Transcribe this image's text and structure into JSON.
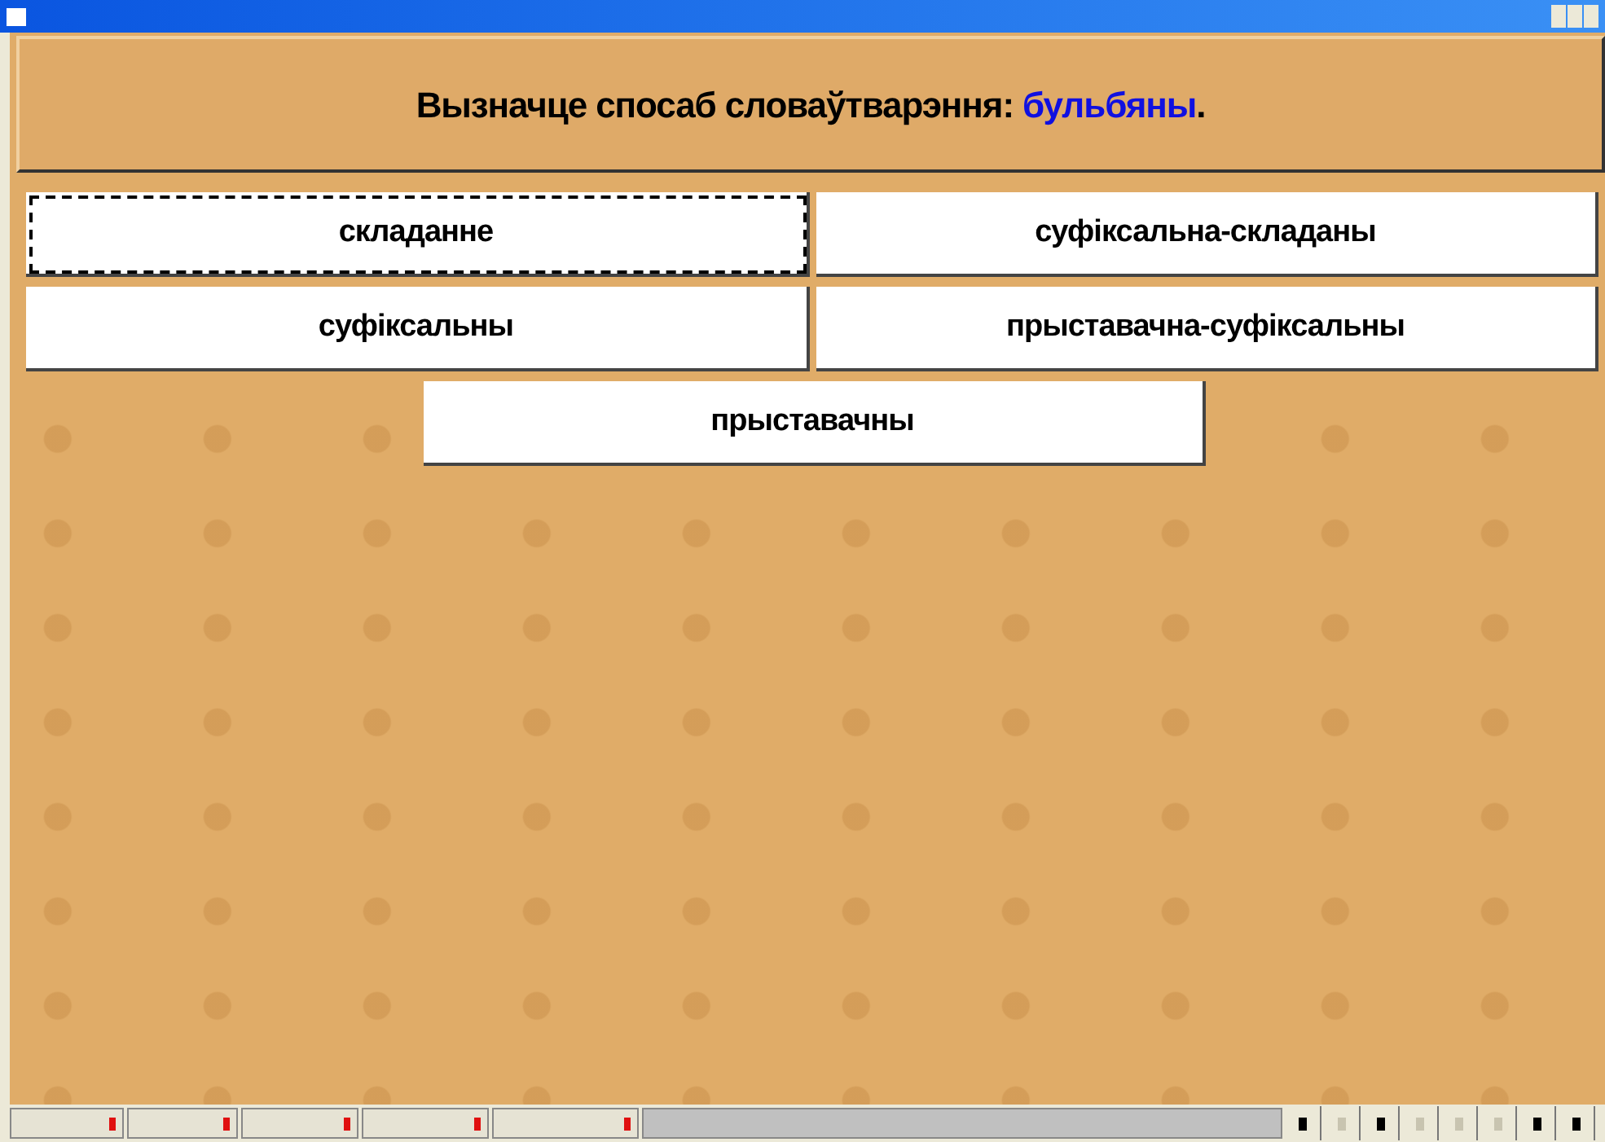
{
  "question": {
    "prompt": "Вызначце спосаб словаўтварэння: ",
    "word": "бульбяны",
    "end": "."
  },
  "options": [
    {
      "label": "складанне",
      "focused": true
    },
    {
      "label": "суфіксальна-складаны",
      "focused": false
    },
    {
      "label": "суфіксальны",
      "focused": false
    },
    {
      "label": "прыставачна-суфіксальны",
      "focused": false
    },
    {
      "label": "прыставачны",
      "focused": false
    }
  ],
  "nav_buttons": [
    {
      "disabled": false
    },
    {
      "disabled": true
    },
    {
      "disabled": false
    },
    {
      "disabled": true
    },
    {
      "disabled": true
    },
    {
      "disabled": true
    },
    {
      "disabled": false
    },
    {
      "disabled": false
    }
  ]
}
